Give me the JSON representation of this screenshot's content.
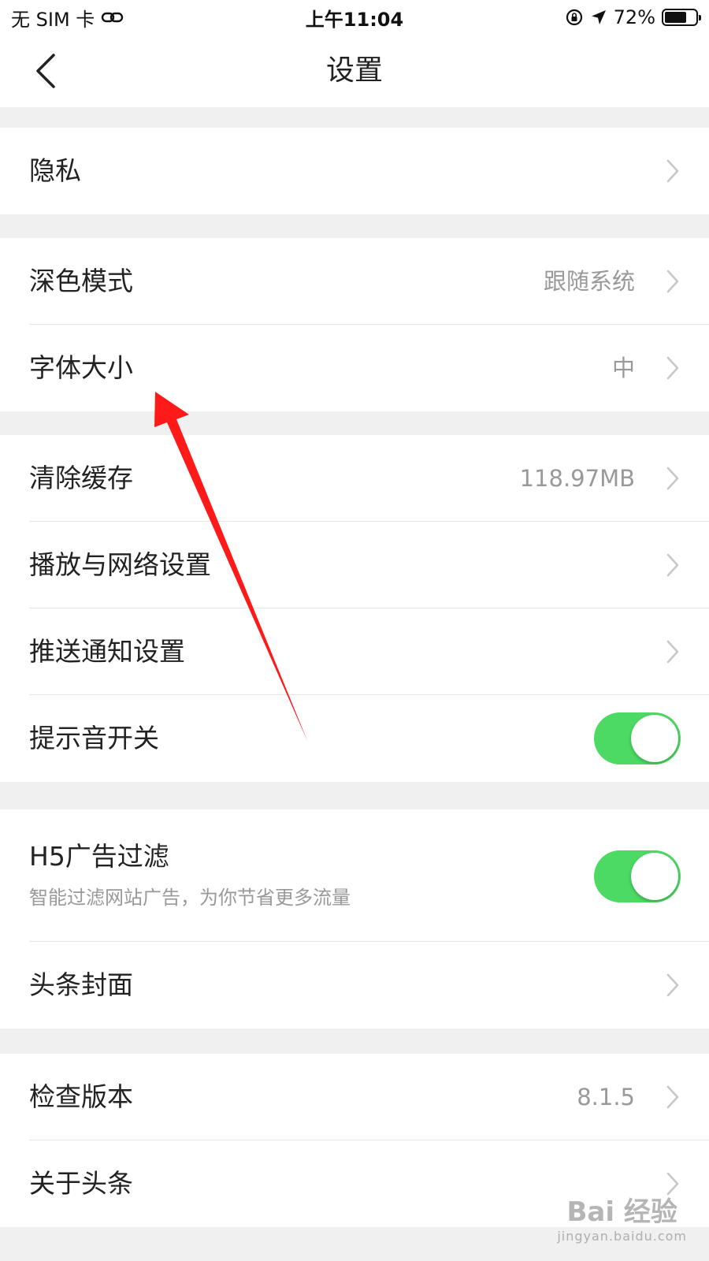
{
  "status_bar": {
    "carrier": "无 SIM 卡",
    "time": "上午11:04",
    "battery": "72%",
    "battery_level": 0.72
  },
  "nav": {
    "title": "设置",
    "back_icon": "chevron-left-icon"
  },
  "groups": [
    {
      "rows": [
        {
          "title": "隐私",
          "value": ""
        }
      ]
    },
    {
      "rows": [
        {
          "title": "深色模式",
          "value": "跟随系统"
        },
        {
          "title": "字体大小",
          "value": "中"
        }
      ]
    },
    {
      "rows": [
        {
          "title": "清除缓存",
          "value": "118.97MB"
        },
        {
          "title": "播放与网络设置",
          "value": ""
        },
        {
          "title": "推送通知设置",
          "value": ""
        },
        {
          "title": "提示音开关",
          "toggle": true
        }
      ]
    },
    {
      "rows": [
        {
          "title": "H5广告过滤",
          "subtitle": "智能过滤网站广告，为你节省更多流量",
          "toggle": true
        },
        {
          "title": "头条封面",
          "value": ""
        }
      ]
    },
    {
      "rows": [
        {
          "title": "检查版本",
          "value": "8.1.5"
        },
        {
          "title": "关于头条",
          "value": ""
        }
      ]
    }
  ],
  "colors": {
    "toggle_on": "#4cd964",
    "annotation_arrow": "#ff1a1a",
    "background": "#f0f0f0"
  },
  "watermark": {
    "main": "Bai 经验",
    "sub": "jingyan.baidu.com"
  }
}
